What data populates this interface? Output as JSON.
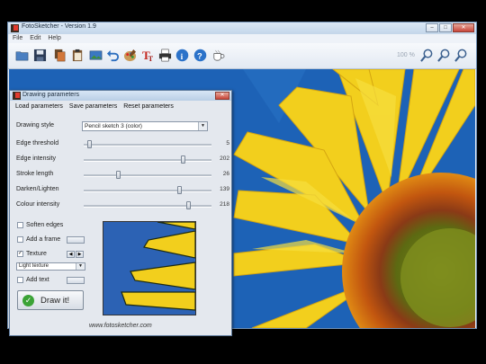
{
  "window": {
    "title": "FotoSketcher - Version 1.9"
  },
  "menu": [
    "File",
    "Edit",
    "Help"
  ],
  "toolbar": {
    "icons": [
      "open-folder-icon",
      "save-icon",
      "copy-icon",
      "paste-icon",
      "picture-icon",
      "undo-icon",
      "palette-icon",
      "text-icon",
      "print-icon",
      "info-icon",
      "help-icon",
      "coffee-cup-icon",
      "zoom-out-icon",
      "zoom-fit-icon",
      "zoom-in-icon"
    ],
    "zoom": "100 %"
  },
  "dialog": {
    "title": "Drawing parameters",
    "menu": {
      "load": "Load parameters",
      "save": "Save parameters",
      "reset": "Reset parameters"
    },
    "drawing_style_label": "Drawing style",
    "drawing_style_value": "Pencil sketch 3 (color)",
    "sliders": [
      {
        "label": "Edge threshold",
        "value": "5",
        "level": 0.03
      },
      {
        "label": "Edge intensity",
        "value": "202",
        "level": 0.79
      },
      {
        "label": "Stroke length",
        "value": "26",
        "level": 0.26
      },
      {
        "label": "Darken/Lighten",
        "value": "139",
        "level": 0.76
      },
      {
        "label": "Colour intensity",
        "value": "218",
        "level": 0.83
      }
    ],
    "soften_edges": "Soften edges",
    "add_frame": "Add a frame",
    "texture": "Texture",
    "texture_value": "Light texture",
    "add_text": "Add text",
    "draw_button": "Draw it!",
    "website": "www.fotosketcher.com"
  },
  "colors": {
    "sky": "#1d62b6",
    "petal": "#f2cf1d",
    "center": "#8a3a16"
  }
}
